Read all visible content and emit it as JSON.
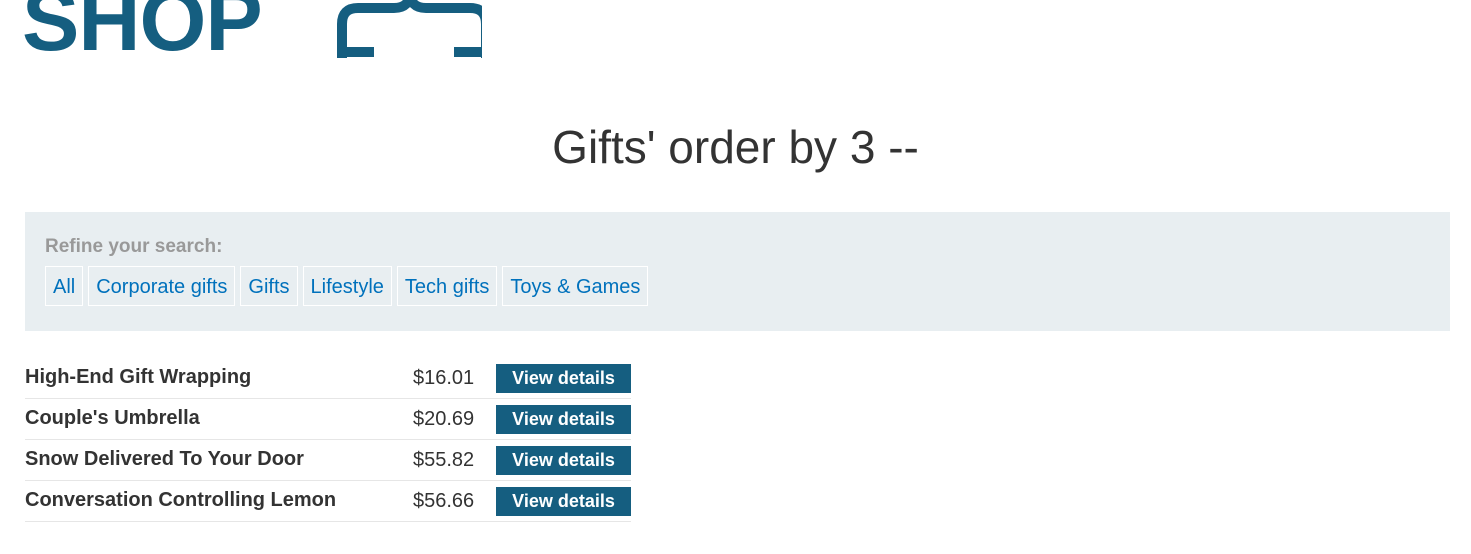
{
  "header": {
    "logo_text": "SHOP",
    "logo_icon": "hanger-icon"
  },
  "page": {
    "title": "Gifts' order by 3 --"
  },
  "filters": {
    "label": "Refine your search:",
    "items": [
      {
        "label": "All"
      },
      {
        "label": "Corporate gifts"
      },
      {
        "label": "Gifts"
      },
      {
        "label": "Lifestyle"
      },
      {
        "label": "Tech gifts"
      },
      {
        "label": "Toys & Games"
      }
    ]
  },
  "products": [
    {
      "name": "High-End Gift Wrapping",
      "price": "$16.01",
      "button": "View details"
    },
    {
      "name": "Couple's Umbrella",
      "price": "$20.69",
      "button": "View details"
    },
    {
      "name": "Snow Delivered To Your Door",
      "price": "$55.82",
      "button": "View details"
    },
    {
      "name": "Conversation Controlling Lemon",
      "price": "$56.66",
      "button": "View details"
    }
  ],
  "colors": {
    "brand": "#155e80",
    "link": "#0071bc",
    "panel_bg": "#e8eef1",
    "muted_label": "#999999"
  }
}
